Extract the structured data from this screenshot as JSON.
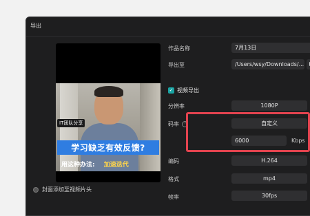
{
  "window": {
    "title": "导出"
  },
  "preview": {
    "tag": "IT团队分享",
    "caption_main": "学习缺乏有效反馈?",
    "caption_sub_left": "用这种办法:",
    "caption_sub_right": "加速迭代"
  },
  "cover_option": {
    "label": "封面添加至视频片头"
  },
  "settings": {
    "name_label": "作品名称",
    "name_value": "7月13日",
    "export_to_label": "导出至",
    "export_to_value": "/Users/wsy/Downloads/...",
    "video_export_label": "视频导出",
    "resolution_label": "分辨率",
    "resolution_value": "1080P",
    "bitrate_label": "码率",
    "bitrate_value": "自定义",
    "bitrate_custom_value": "6000",
    "bitrate_unit": "Kbps",
    "codec_label": "编码",
    "codec_value": "H.264",
    "format_label": "格式",
    "format_value": "mp4",
    "framerate_label": "帧率",
    "framerate_value": "30fps"
  },
  "colors": {
    "window_bg": "#1e1e1f",
    "field_bg": "#2f2f31",
    "accent": "#1aa3a3",
    "highlight": "#e3434f",
    "caption_blue": "#2f7de1",
    "caption_yellow": "#ffd54a"
  }
}
